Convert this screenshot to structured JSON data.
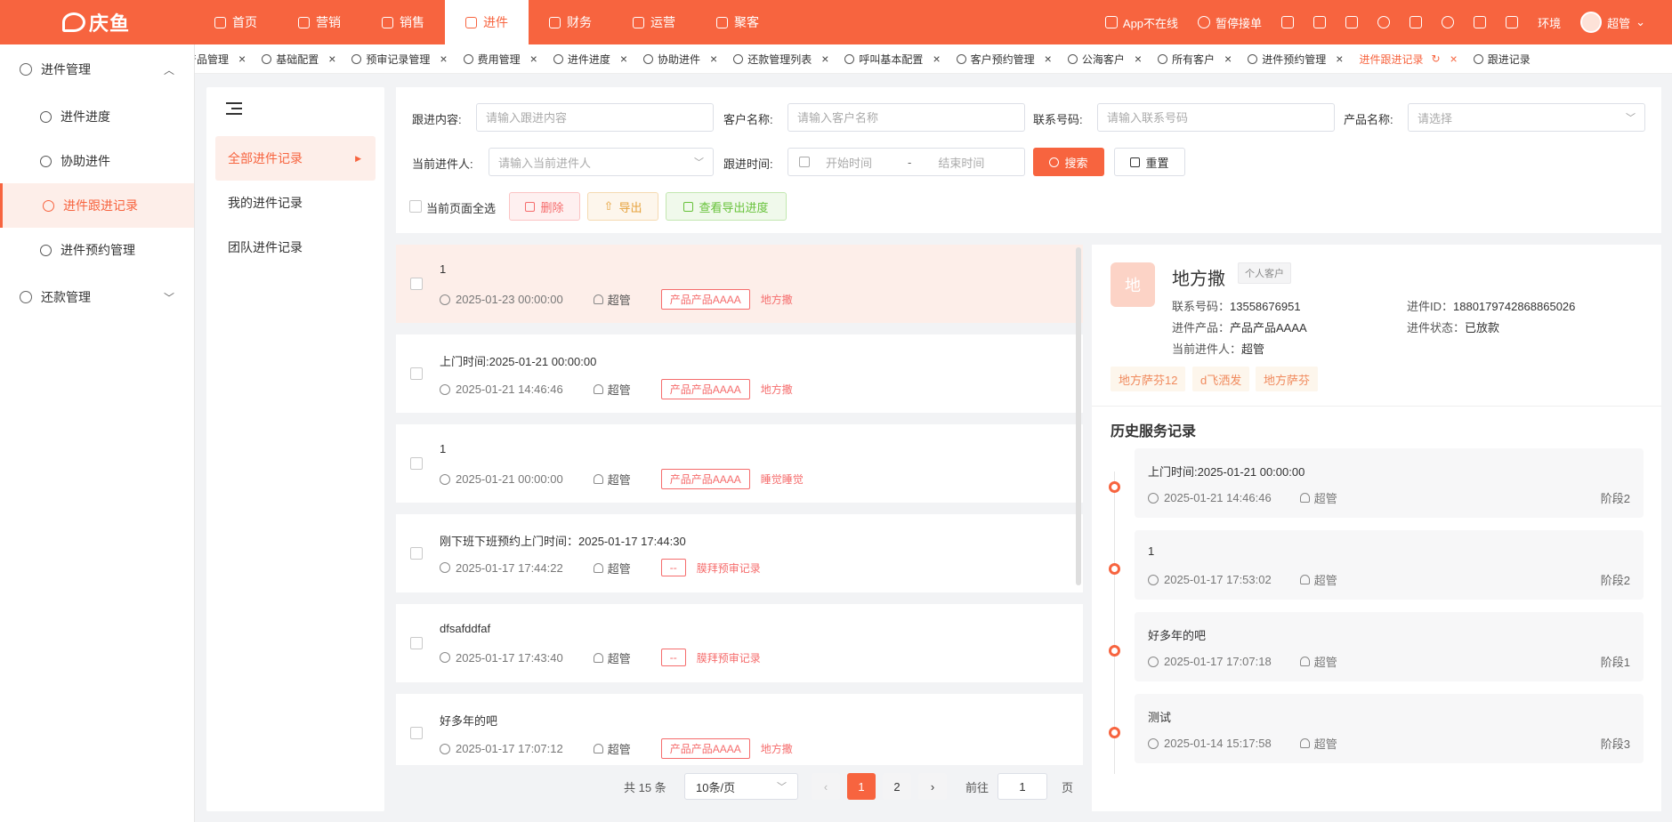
{
  "brand": {
    "name": "庆鱼"
  },
  "top_nav": [
    {
      "label": "首页",
      "icon": "home-icon"
    },
    {
      "label": "营销",
      "icon": "marketing-icon"
    },
    {
      "label": "销售",
      "icon": "sales-icon"
    },
    {
      "label": "进件",
      "icon": "application-icon",
      "active": true
    },
    {
      "label": "财务",
      "icon": "finance-icon"
    },
    {
      "label": "运营",
      "icon": "operations-icon"
    },
    {
      "label": "聚客",
      "icon": "customers-icon"
    }
  ],
  "top_right": {
    "app_status": "App不在线",
    "pause": "暂停接单",
    "env": "环境",
    "user": "超管"
  },
  "sidebar": {
    "group1": "进件管理",
    "items": [
      "进件进度",
      "协助进件",
      "进件跟进记录",
      "进件预约管理"
    ],
    "group2": "还款管理"
  },
  "tabs": [
    {
      "label": "产品管理",
      "partial": "产品管理"
    },
    {
      "label": "基础配置"
    },
    {
      "label": "预审记录管理"
    },
    {
      "label": "费用管理"
    },
    {
      "label": "进件进度"
    },
    {
      "label": "协助进件"
    },
    {
      "label": "还款管理列表"
    },
    {
      "label": "呼叫基本配置"
    },
    {
      "label": "客户预约管理"
    },
    {
      "label": "公海客户"
    },
    {
      "label": "所有客户"
    },
    {
      "label": "进件预约管理"
    },
    {
      "label": "进件跟进记录",
      "active": true
    },
    {
      "label": "跟进记录"
    }
  ],
  "left_menu": [
    "全部进件记录",
    "我的进件记录",
    "团队进件记录"
  ],
  "filters": {
    "content_label": "跟进内容:",
    "content_ph": "请输入跟进内容",
    "customer_label": "客户名称:",
    "customer_ph": "请输入客户名称",
    "phone_label": "联系号码:",
    "phone_ph": "请输入联系号码",
    "product_label": "产品名称:",
    "product_ph": "请选择",
    "owner_label": "当前进件人:",
    "owner_ph": "请输入当前进件人",
    "time_label": "跟进时间:",
    "start_ph": "开始时间",
    "range_sep": "-",
    "end_ph": "结束时间",
    "search": "搜索",
    "reset": "重置",
    "select_all": "当前页面全选",
    "delete": "删除",
    "export": "导出",
    "view_export": "查看导出进度"
  },
  "records": [
    {
      "title": "1",
      "time": "2025-01-23 00:00:00",
      "user": "超管",
      "tag": "产品产品AAAA",
      "customer": "地方撒"
    },
    {
      "title": "上门时间:2025-01-21 00:00:00",
      "time": "2025-01-21 14:46:46",
      "user": "超管",
      "tag": "产品产品AAAA",
      "customer": "地方撒"
    },
    {
      "title": "1",
      "time": "2025-01-21 00:00:00",
      "user": "超管",
      "tag": "产品产品AAAA",
      "customer": "睡觉睡觉"
    },
    {
      "title": "刚下班下班预约上门时间：2025-01-17 17:44:30",
      "time": "2025-01-17 17:44:22",
      "user": "超管",
      "tag": "--",
      "customer": "膜拜预审记录"
    },
    {
      "title": "dfsafddfaf",
      "time": "2025-01-17 17:43:40",
      "user": "超管",
      "tag": "--",
      "customer": "膜拜预审记录"
    },
    {
      "title": "好多年的吧",
      "time": "2025-01-17 17:07:12",
      "user": "超管",
      "tag": "产品产品AAAA",
      "customer": "地方撒"
    }
  ],
  "pagination": {
    "total": "共 15 条",
    "page_size": "10条/页",
    "pages": [
      "1",
      "2"
    ],
    "goto": "前往",
    "goto_value": "1",
    "page_unit": "页"
  },
  "detail": {
    "avatar": "地",
    "name": "地方撒",
    "type": "个人客户",
    "phone_label": "联系号码：",
    "phone": "13558676951",
    "id_label": "进件ID：",
    "id": "1880179742868865026",
    "product_label": "进件产品：",
    "product": "产品产品AAAA",
    "status_label": "进件状态：",
    "status": "已放款",
    "owner_label": "当前进件人：",
    "owner": "超管",
    "tags": [
      "地方萨芬12",
      "d飞洒发",
      "地方萨芬"
    ],
    "history_title": "历史服务记录",
    "history": [
      {
        "title": "上门时间:2025-01-21 00:00:00",
        "time": "2025-01-21 14:46:46",
        "user": "超管",
        "stage": "阶段2"
      },
      {
        "title": "1",
        "time": "2025-01-17 17:53:02",
        "user": "超管",
        "stage": "阶段2"
      },
      {
        "title": "好多年的吧",
        "time": "2025-01-17 17:07:18",
        "user": "超管",
        "stage": "阶段1"
      },
      {
        "title": "测试",
        "time": "2025-01-14 15:17:58",
        "user": "超管",
        "stage": "阶段3"
      }
    ]
  },
  "colors": {
    "accent": "#f7643f",
    "danger": "#f56c6c",
    "warn": "#e6a23c",
    "success": "#67c23a"
  }
}
